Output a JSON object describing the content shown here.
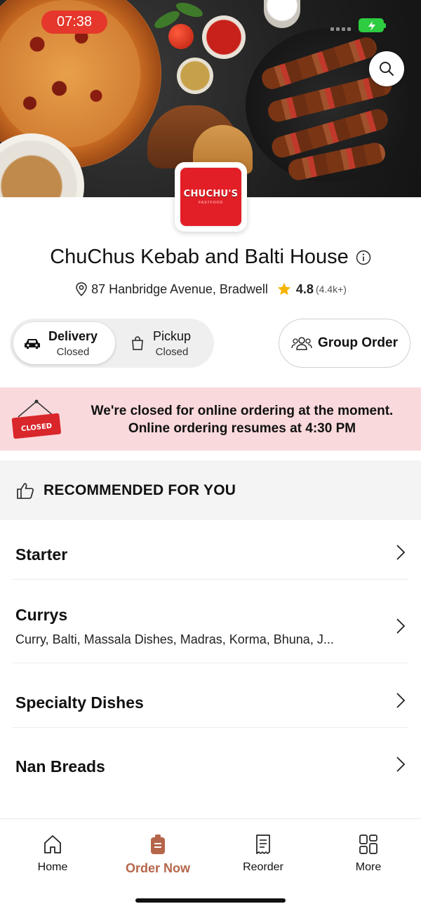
{
  "status_bar": {
    "time": "07:38",
    "battery_color": "#2ecc40",
    "pill_color": "#e5372b"
  },
  "hero": {
    "search_icon": "search-icon"
  },
  "restaurant": {
    "logo_text": "CHUCHU'S",
    "logo_subtext": "FASTFOOD",
    "name": "ChuChus Kebab and Balti House",
    "address": "87 Hanbridge Avenue, Bradwell",
    "rating": "4.8",
    "rating_count": "(4.4k+)",
    "brand_color": "#e21f26"
  },
  "order_mode": {
    "delivery": {
      "label": "Delivery",
      "status": "Closed"
    },
    "pickup": {
      "label": "Pickup",
      "status": "Closed"
    },
    "group_order_label": "Group Order"
  },
  "closed_banner": {
    "sign_text": "CLOSED",
    "line1": "We're closed for online ordering at the moment.",
    "line2": "Online ordering resumes at 4:30 PM",
    "background": "#f9d9dc"
  },
  "recommended": {
    "label": "RECOMMENDED FOR YOU"
  },
  "categories": [
    {
      "name": "Starter",
      "description": ""
    },
    {
      "name": "Currys",
      "description": "Curry, Balti, Massala Dishes, Madras, Korma, Bhuna, J..."
    },
    {
      "name": "Specialty Dishes",
      "description": ""
    },
    {
      "name": "Nan Breads",
      "description": ""
    }
  ],
  "bottom_nav": {
    "active_color": "#b5654a",
    "items": [
      {
        "label": "Home",
        "icon": "home-icon"
      },
      {
        "label": "Order Now",
        "icon": "order-bag-icon"
      },
      {
        "label": "Reorder",
        "icon": "receipt-icon"
      },
      {
        "label": "More",
        "icon": "grid-icon"
      }
    ]
  }
}
